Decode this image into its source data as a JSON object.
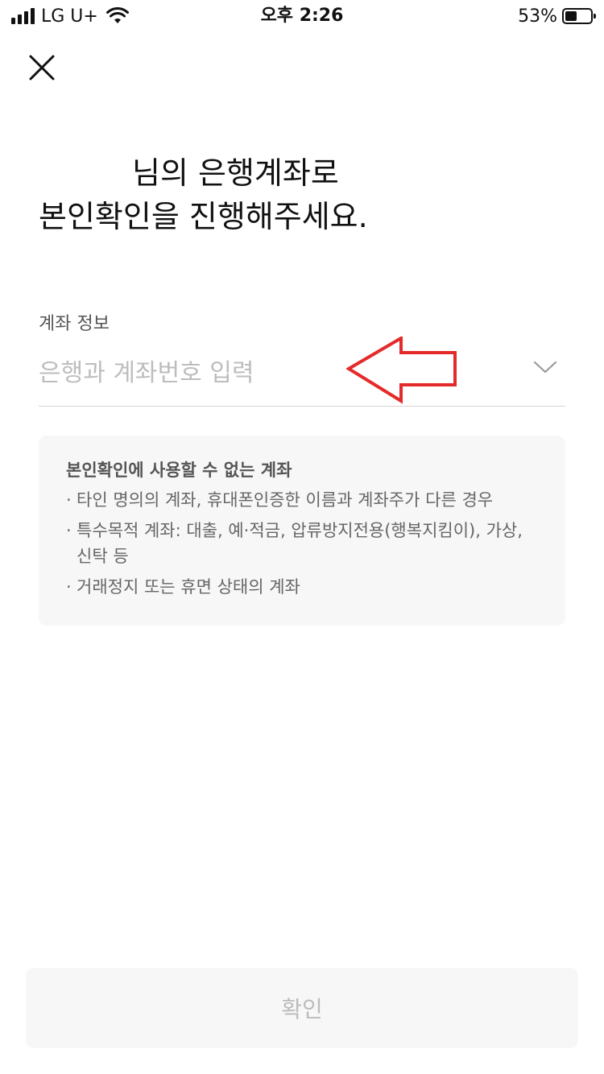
{
  "status_bar": {
    "carrier": "LG U+",
    "time": "오후 2:26",
    "battery_percent": "53%",
    "battery_level": 0.53,
    "signal_bars": 4,
    "icons": [
      "signal-icon",
      "wifi-icon",
      "battery-icon"
    ]
  },
  "header": {
    "close_icon": "close-icon"
  },
  "title": {
    "line1": "님의 은행계좌로",
    "line2": "본인확인을 진행해주세요."
  },
  "account_field": {
    "label": "계좌 정보",
    "placeholder": "은행과 계좌번호 입력",
    "icon": "chevron-down-icon"
  },
  "annotation": {
    "icon": "red-arrow-icon",
    "color": "#e52a2a"
  },
  "info_box": {
    "title": "본인확인에 사용할 수 없는 계좌",
    "bullet": "·",
    "items": [
      "타인 명의의 계좌, 휴대폰인증한 이름과 계좌주가 다른 경우",
      "특수목적 계좌: 대출, 예·적금, 압류방지전용(행복지킴이), 가상, 신탁 등",
      "거래정지 또는 휴면 상태의 계좌"
    ]
  },
  "confirm_button": {
    "label": "확인",
    "enabled": false
  }
}
